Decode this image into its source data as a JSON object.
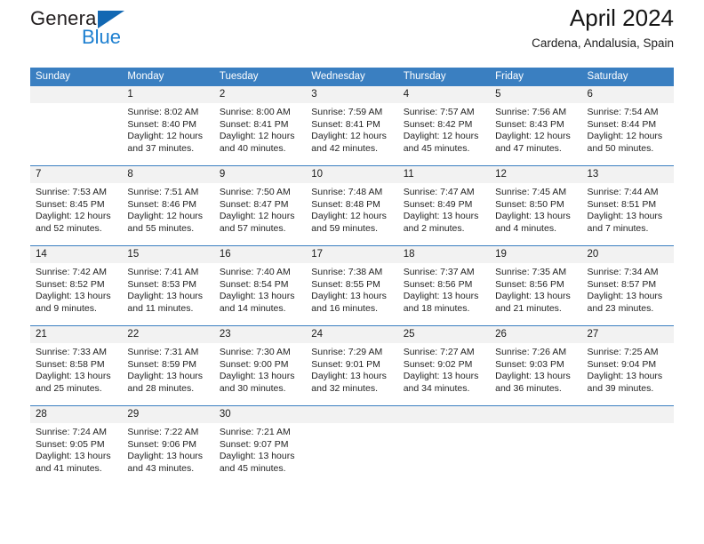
{
  "brand": {
    "name_top": "General",
    "name_bottom": "Blue",
    "triangle_color": "#1268b3",
    "blue_text_color": "#1c7fd0"
  },
  "header": {
    "title": "April 2024",
    "subtitle": "Cardena, Andalusia, Spain"
  },
  "colors": {
    "header_row_bg": "#3a7fc1",
    "header_row_text": "#ffffff",
    "daynum_band_bg": "#f2f2f2",
    "week_divider": "#3a7fc1",
    "cell_bg": "#ffffff",
    "body_text": "#232323"
  },
  "calendar": {
    "day_names": [
      "Sunday",
      "Monday",
      "Tuesday",
      "Wednesday",
      "Thursday",
      "Friday",
      "Saturday"
    ],
    "weeks": [
      [
        {
          "day": "",
          "lines": []
        },
        {
          "day": "1",
          "lines": [
            "Sunrise: 8:02 AM",
            "Sunset: 8:40 PM",
            "Daylight: 12 hours",
            "and 37 minutes."
          ]
        },
        {
          "day": "2",
          "lines": [
            "Sunrise: 8:00 AM",
            "Sunset: 8:41 PM",
            "Daylight: 12 hours",
            "and 40 minutes."
          ]
        },
        {
          "day": "3",
          "lines": [
            "Sunrise: 7:59 AM",
            "Sunset: 8:41 PM",
            "Daylight: 12 hours",
            "and 42 minutes."
          ]
        },
        {
          "day": "4",
          "lines": [
            "Sunrise: 7:57 AM",
            "Sunset: 8:42 PM",
            "Daylight: 12 hours",
            "and 45 minutes."
          ]
        },
        {
          "day": "5",
          "lines": [
            "Sunrise: 7:56 AM",
            "Sunset: 8:43 PM",
            "Daylight: 12 hours",
            "and 47 minutes."
          ]
        },
        {
          "day": "6",
          "lines": [
            "Sunrise: 7:54 AM",
            "Sunset: 8:44 PM",
            "Daylight: 12 hours",
            "and 50 minutes."
          ]
        }
      ],
      [
        {
          "day": "7",
          "lines": [
            "Sunrise: 7:53 AM",
            "Sunset: 8:45 PM",
            "Daylight: 12 hours",
            "and 52 minutes."
          ]
        },
        {
          "day": "8",
          "lines": [
            "Sunrise: 7:51 AM",
            "Sunset: 8:46 PM",
            "Daylight: 12 hours",
            "and 55 minutes."
          ]
        },
        {
          "day": "9",
          "lines": [
            "Sunrise: 7:50 AM",
            "Sunset: 8:47 PM",
            "Daylight: 12 hours",
            "and 57 minutes."
          ]
        },
        {
          "day": "10",
          "lines": [
            "Sunrise: 7:48 AM",
            "Sunset: 8:48 PM",
            "Daylight: 12 hours",
            "and 59 minutes."
          ]
        },
        {
          "day": "11",
          "lines": [
            "Sunrise: 7:47 AM",
            "Sunset: 8:49 PM",
            "Daylight: 13 hours",
            "and 2 minutes."
          ]
        },
        {
          "day": "12",
          "lines": [
            "Sunrise: 7:45 AM",
            "Sunset: 8:50 PM",
            "Daylight: 13 hours",
            "and 4 minutes."
          ]
        },
        {
          "day": "13",
          "lines": [
            "Sunrise: 7:44 AM",
            "Sunset: 8:51 PM",
            "Daylight: 13 hours",
            "and 7 minutes."
          ]
        }
      ],
      [
        {
          "day": "14",
          "lines": [
            "Sunrise: 7:42 AM",
            "Sunset: 8:52 PM",
            "Daylight: 13 hours",
            "and 9 minutes."
          ]
        },
        {
          "day": "15",
          "lines": [
            "Sunrise: 7:41 AM",
            "Sunset: 8:53 PM",
            "Daylight: 13 hours",
            "and 11 minutes."
          ]
        },
        {
          "day": "16",
          "lines": [
            "Sunrise: 7:40 AM",
            "Sunset: 8:54 PM",
            "Daylight: 13 hours",
            "and 14 minutes."
          ]
        },
        {
          "day": "17",
          "lines": [
            "Sunrise: 7:38 AM",
            "Sunset: 8:55 PM",
            "Daylight: 13 hours",
            "and 16 minutes."
          ]
        },
        {
          "day": "18",
          "lines": [
            "Sunrise: 7:37 AM",
            "Sunset: 8:56 PM",
            "Daylight: 13 hours",
            "and 18 minutes."
          ]
        },
        {
          "day": "19",
          "lines": [
            "Sunrise: 7:35 AM",
            "Sunset: 8:56 PM",
            "Daylight: 13 hours",
            "and 21 minutes."
          ]
        },
        {
          "day": "20",
          "lines": [
            "Sunrise: 7:34 AM",
            "Sunset: 8:57 PM",
            "Daylight: 13 hours",
            "and 23 minutes."
          ]
        }
      ],
      [
        {
          "day": "21",
          "lines": [
            "Sunrise: 7:33 AM",
            "Sunset: 8:58 PM",
            "Daylight: 13 hours",
            "and 25 minutes."
          ]
        },
        {
          "day": "22",
          "lines": [
            "Sunrise: 7:31 AM",
            "Sunset: 8:59 PM",
            "Daylight: 13 hours",
            "and 28 minutes."
          ]
        },
        {
          "day": "23",
          "lines": [
            "Sunrise: 7:30 AM",
            "Sunset: 9:00 PM",
            "Daylight: 13 hours",
            "and 30 minutes."
          ]
        },
        {
          "day": "24",
          "lines": [
            "Sunrise: 7:29 AM",
            "Sunset: 9:01 PM",
            "Daylight: 13 hours",
            "and 32 minutes."
          ]
        },
        {
          "day": "25",
          "lines": [
            "Sunrise: 7:27 AM",
            "Sunset: 9:02 PM",
            "Daylight: 13 hours",
            "and 34 minutes."
          ]
        },
        {
          "day": "26",
          "lines": [
            "Sunrise: 7:26 AM",
            "Sunset: 9:03 PM",
            "Daylight: 13 hours",
            "and 36 minutes."
          ]
        },
        {
          "day": "27",
          "lines": [
            "Sunrise: 7:25 AM",
            "Sunset: 9:04 PM",
            "Daylight: 13 hours",
            "and 39 minutes."
          ]
        }
      ],
      [
        {
          "day": "28",
          "lines": [
            "Sunrise: 7:24 AM",
            "Sunset: 9:05 PM",
            "Daylight: 13 hours",
            "and 41 minutes."
          ]
        },
        {
          "day": "29",
          "lines": [
            "Sunrise: 7:22 AM",
            "Sunset: 9:06 PM",
            "Daylight: 13 hours",
            "and 43 minutes."
          ]
        },
        {
          "day": "30",
          "lines": [
            "Sunrise: 7:21 AM",
            "Sunset: 9:07 PM",
            "Daylight: 13 hours",
            "and 45 minutes."
          ]
        },
        {
          "day": "",
          "lines": []
        },
        {
          "day": "",
          "lines": []
        },
        {
          "day": "",
          "lines": []
        },
        {
          "day": "",
          "lines": []
        }
      ]
    ]
  }
}
